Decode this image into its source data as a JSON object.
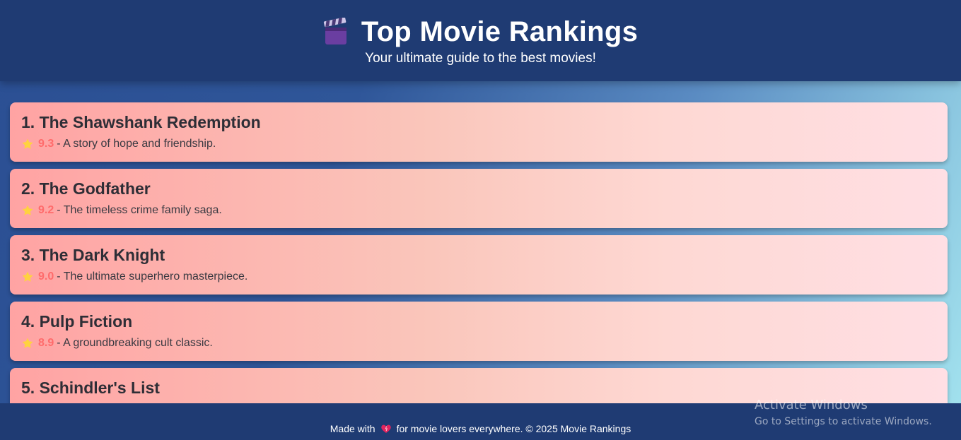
{
  "header": {
    "title": "Top Movie Rankings",
    "subtitle": "Your ultimate guide to the best movies!",
    "icon": "clapperboard-icon"
  },
  "movies": [
    {
      "title": "1. The Shawshank Redemption",
      "rating": "9.3",
      "description": " - A story of hope and friendship."
    },
    {
      "title": "2. The Godfather",
      "rating": "9.2",
      "description": " - The timeless crime family saga."
    },
    {
      "title": "3. The Dark Knight",
      "rating": "9.0",
      "description": " - The ultimate superhero masterpiece."
    },
    {
      "title": "4. Pulp Fiction",
      "rating": "8.9",
      "description": " - A groundbreaking cult classic."
    },
    {
      "title": "5. Schindler's List",
      "rating": "",
      "description": ""
    }
  ],
  "footer": {
    "prefix": "Made with",
    "suffix": "for movie lovers everywhere. © 2025 Movie Rankings",
    "icon": "heart-icon"
  },
  "watermark": {
    "title": "Activate Windows",
    "subtitle": "Go to Settings to activate Windows."
  },
  "colors": {
    "header_bg": "#1f3b73",
    "rating": "#ff6b6b",
    "card_start": "#ffa3a3",
    "card_end": "#ffdfe4"
  }
}
